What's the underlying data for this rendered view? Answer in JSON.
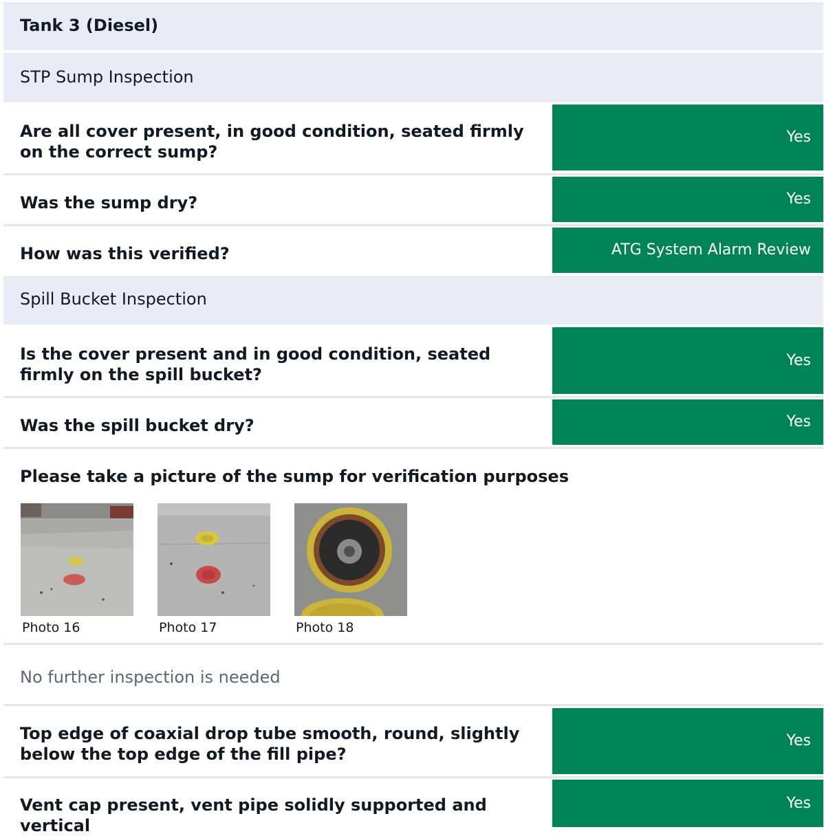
{
  "tank": {
    "title": "Tank 3 (Diesel)"
  },
  "sections": {
    "stp": "STP Sump Inspection",
    "spill": "Spill Bucket Inspection"
  },
  "questions": [
    {
      "text": "Are all cover present, in good condition, seated firmly on the correct sump?",
      "answer": "Yes"
    },
    {
      "text": "Was the sump dry?",
      "answer": "Yes"
    },
    {
      "text": "How was this verified?",
      "answer": "ATG System Alarm Review"
    },
    {
      "text": "Is the cover present and in good condition, seated firmly on the spill bucket?",
      "answer": "Yes"
    },
    {
      "text": "Was the spill bucket dry?",
      "answer": "Yes"
    },
    {
      "text": "Top edge of coaxial drop tube smooth, round, slightly below the top edge of the fill pipe?",
      "answer": "Yes"
    },
    {
      "text": "Vent cap present, vent pipe solidly supported and vertical",
      "answer": "Yes"
    }
  ],
  "photo_prompt": "Please take a picture of the sump for verification purposes",
  "photos": [
    {
      "caption": "Photo 16"
    },
    {
      "caption": "Photo 17"
    },
    {
      "caption": "Photo 18"
    }
  ],
  "note": "No further inspection is needed",
  "colors": {
    "answer_bg": "#008357",
    "band_bg": "#e8ecf5"
  }
}
